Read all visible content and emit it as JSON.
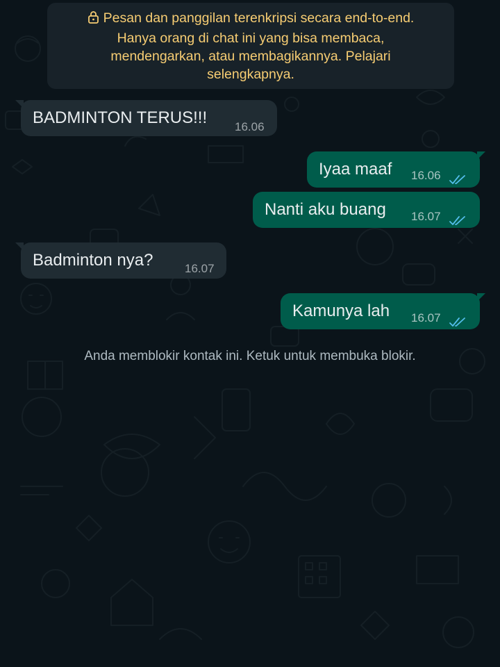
{
  "encryption_notice": {
    "icon": "lock-icon",
    "line1": "Pesan dan panggilan terenkripsi secara end-to-end.",
    "line2": "Hanya orang di chat ini yang bisa membaca,",
    "line3": "mendengarkan, atau membagikannya. Pelajari",
    "line4": "selengkapnya."
  },
  "messages": [
    {
      "direction": "incoming",
      "text": "BADMINTON TERUS!!!",
      "time": "16.06"
    },
    {
      "direction": "outgoing",
      "text": "Iyaa maaf",
      "time": "16.06",
      "status_icon": "double-check-icon"
    },
    {
      "direction": "outgoing",
      "text": "Nanti aku buang",
      "time": "16.07",
      "status_icon": "double-check-icon"
    },
    {
      "direction": "incoming",
      "text": "Badminton nya?",
      "time": "16.07"
    },
    {
      "direction": "outgoing",
      "text": "Kamunya lah",
      "time": "16.07",
      "status_icon": "double-check-icon"
    }
  ],
  "blocked_notice": "Anda memblokir kontak ini. Ketuk untuk membuka blokir.",
  "colors": {
    "background": "#0b141a",
    "incoming_bubble": "#202c33",
    "outgoing_bubble": "#005c4b",
    "notice_text": "#f7cd73",
    "read_tick": "#53bdeb"
  }
}
